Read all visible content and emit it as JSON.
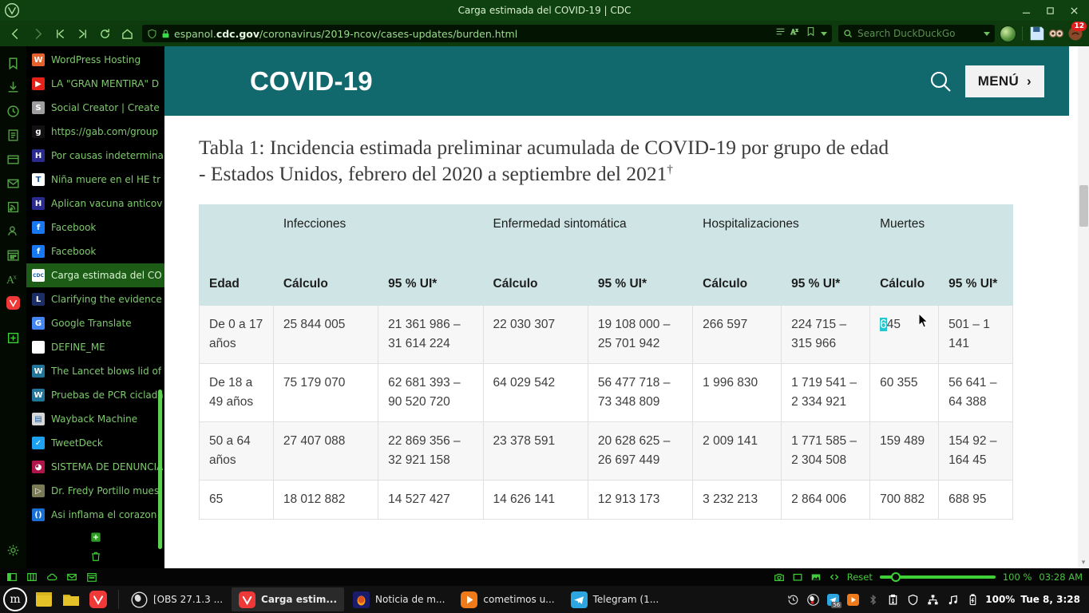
{
  "window": {
    "title": "Carga estimada del COVID-19 | CDC",
    "minimize": "–",
    "maximize": "❐",
    "close": "✕"
  },
  "toolbar": {
    "back_icon": "back-arrow-icon",
    "forward_icon": "forward-arrow-icon",
    "rewind_icon": "rewind-icon",
    "fastforward_icon": "fast-forward-icon",
    "reload_icon": "reload-icon",
    "home_icon": "home-icon",
    "url": "espanol.cdc.gov/coronavirus/2019-ncov/cases-updates/burden.html",
    "url_domain": "cdc.gov",
    "url_prefix": "espanol.",
    "url_suffix": "/coronavirus/2019-ncov/cases-updates/burden.html",
    "search_placeholder": "Search DuckDuckGo",
    "extension_badge": "12"
  },
  "panel_icons": [
    "bookmarks-panel-icon",
    "downloads-panel-icon",
    "history-panel-icon",
    "notes-panel-icon",
    "window-panel-icon",
    "mail-panel-icon",
    "feeds-panel-icon",
    "contacts-panel-icon",
    "calendar-panel-icon",
    "translate-panel-icon",
    "vivaldi-panel-icon",
    "add-panel-icon",
    "settings-panel-icon"
  ],
  "bookmarks": {
    "items": [
      {
        "label": "WordPress Hosting",
        "favicon": "wordpress-favicon",
        "color": "#e8602c",
        "glyph": "W",
        "selected": false
      },
      {
        "label": "LA \"GRAN MENTIRA\" D",
        "favicon": "youtube-favicon",
        "color": "#e62117",
        "glyph": "▶",
        "selected": false
      },
      {
        "label": "Social Creator | Create",
        "favicon": "social-creator-favicon",
        "color": "#9e9e9e",
        "glyph": "S",
        "selected": false
      },
      {
        "label": "https://gab.com/group",
        "favicon": "gab-favicon",
        "color": "#111111",
        "glyph": "g",
        "selected": false
      },
      {
        "label": "Por causas indetermina",
        "favicon": "h-favicon",
        "color": "#2b2b8f",
        "glyph": "H",
        "selected": false
      },
      {
        "label": "Niña muere en el HE tr",
        "favicon": "telegraph-favicon",
        "color": "#ffffff",
        "glyph": "T",
        "selected": false
      },
      {
        "label": "Aplican vacuna anticov",
        "favicon": "h-favicon",
        "color": "#2b2b8f",
        "glyph": "H",
        "selected": false
      },
      {
        "label": "Facebook",
        "favicon": "facebook-favicon",
        "color": "#1877f2",
        "glyph": "f",
        "selected": false
      },
      {
        "label": "Facebook",
        "favicon": "facebook-favicon",
        "color": "#1877f2",
        "glyph": "f",
        "selected": false
      },
      {
        "label": "Carga estimada del CO",
        "favicon": "cdc-favicon",
        "color": "#ffffff",
        "glyph": "CDC",
        "selected": true
      },
      {
        "label": "Clarifying the evidence",
        "favicon": "lancet-favicon",
        "color": "#1c2e66",
        "glyph": "L",
        "selected": false
      },
      {
        "label": "Google Translate",
        "favicon": "google-translate-favicon",
        "color": "#4285f4",
        "glyph": "G",
        "selected": false
      },
      {
        "label": "DEFINE_ME",
        "favicon": "blank-favicon",
        "color": "#ffffff",
        "glyph": "",
        "selected": false
      },
      {
        "label": "The Lancet blows lid of",
        "favicon": "wordpress-favicon",
        "color": "#21759b",
        "glyph": "W",
        "selected": false
      },
      {
        "label": "Pruebas de PCR ciclada",
        "favicon": "wordpress-favicon",
        "color": "#21759b",
        "glyph": "W",
        "selected": false
      },
      {
        "label": "Wayback Machine",
        "favicon": "document-favicon",
        "color": "#d8d8d8",
        "glyph": "▤",
        "selected": false
      },
      {
        "label": "TweetDeck",
        "favicon": "twitter-favicon",
        "color": "#1da1f2",
        "glyph": "✓",
        "selected": false
      },
      {
        "label": "SISTEMA DE DENUNCIA",
        "favicon": "denuncia-favicon",
        "color": "#b0144a",
        "glyph": "◕",
        "selected": false
      },
      {
        "label": "Dr. Fredy Portillo mues",
        "favicon": "bitchute-favicon",
        "color": "#7a7a55",
        "glyph": "▷",
        "selected": false
      },
      {
        "label": "Asi inflama el corazon l",
        "favicon": "link-favicon",
        "color": "#1a6fd4",
        "glyph": "()",
        "selected": false
      }
    ],
    "add_icon": "add-bookmark-icon",
    "delete_icon": "trash-icon"
  },
  "cdc_page": {
    "brand": "COVID-19",
    "search_icon": "search-icon",
    "menu_label": "MENÚ",
    "menu_chevron": "›",
    "table_caption": "Tabla 1: Incidencia estimada preliminar acumulada de COVID-19 por grupo de edad - Estados Unidos, febrero del 2020 a septiembre del 2021",
    "caption_dagger": "†"
  },
  "chart_data": {
    "type": "table",
    "title": "Tabla 1: Incidencia estimada preliminar acumulada de COVID-19 por grupo de edad - Estados Unidos, febrero del 2020 a septiembre del 2021†",
    "group_headers": [
      "",
      "Infecciones",
      "",
      "Enfermedad sintomática",
      "",
      "Hospitalizaciones",
      "",
      "Muertes",
      ""
    ],
    "columns": [
      "Edad",
      "Cálculo",
      "95 % UI*",
      "Cálculo",
      "95 % UI*",
      "Cálculo",
      "95 % UI*",
      "Cálculo",
      "95 % UI*"
    ],
    "rows": [
      {
        "edad": "De 0 a 17 años",
        "inf_calculo": "25 844 005",
        "inf_ui": "21 361 986 – 31 614 224",
        "sint_calculo": "22 030 307",
        "sint_ui": "19 108 000 – 25 701 942",
        "hosp_calculo": "266 597",
        "hosp_ui": "224 715 – 315 966",
        "muertes_calculo": "645",
        "muertes_calculo_selected_prefix": "6",
        "muertes_calculo_rest": "45",
        "muertes_ui": "501 – 1 141"
      },
      {
        "edad": "De 18 a 49 años",
        "inf_calculo": "75 179 070",
        "inf_ui": "62 681 393 – 90 520 720",
        "sint_calculo": "64 029 542",
        "sint_ui": "56 477 718 – 73 348 809",
        "hosp_calculo": "1 996 830",
        "hosp_ui": "1 719 541 – 2 334 921",
        "muertes_calculo": "60 355",
        "muertes_ui": "56 641 – 64 388"
      },
      {
        "edad": "50 a 64 años",
        "inf_calculo": "27 407 088",
        "inf_ui": "22 869 356 – 32 921 158",
        "sint_calculo": "23 378 591",
        "sint_ui": "20 628 625 – 26 697 449",
        "hosp_calculo": "2 009 141",
        "hosp_ui": "1 771 585 – 2 304 508",
        "muertes_calculo": "159 489",
        "muertes_ui": "154 92 – 164 45"
      },
      {
        "edad": "65",
        "inf_calculo": "18 012 882",
        "inf_ui": "14 527 427",
        "sint_calculo": "14 626 141",
        "sint_ui": "12 913 173",
        "hosp_calculo": "3 232 213",
        "hosp_ui": "2 864 006",
        "muertes_calculo": "700 882",
        "muertes_ui": "688 95"
      }
    ]
  },
  "obs_strip": {
    "camera_icon": "screenshot-icon",
    "window_icon": "window-capture-icon",
    "image_icon": "image-capture-icon",
    "code_icon": "code-icon",
    "reset_label": "Reset",
    "zoom_value": "100 %",
    "clock": "03:28 AM"
  },
  "taskbar": {
    "start_glyph": "m",
    "launchers": [
      "notes-launcher",
      "files-launcher",
      "vivaldi-launcher"
    ],
    "items": [
      {
        "label": "[OBS 27.1.3 ...",
        "icon": "obs-icon",
        "color": "#3a3a3a",
        "active": false
      },
      {
        "label": "Carga estim...",
        "icon": "vivaldi-icon",
        "color": "#ef3939",
        "active": true
      },
      {
        "label": "Noticia de m...",
        "icon": "firefox-icon",
        "color": "#1b1b6b",
        "active": false
      },
      {
        "label": "cometimos u...",
        "icon": "vlc-icon",
        "color": "#ee7a1b",
        "active": false
      },
      {
        "label": "Telegram (1...",
        "icon": "telegram-icon",
        "color": "#2ca5e0",
        "active": false
      }
    ],
    "tray_apps": [
      {
        "icon": "history-tray-icon",
        "badge": ""
      },
      {
        "icon": "obs-tray-icon",
        "badge": ""
      },
      {
        "icon": "telegram-tray-icon",
        "badge": "56"
      },
      {
        "icon": "vlc-tray-icon",
        "badge": ""
      }
    ],
    "tray_icons": [
      "bluetooth-icon",
      "clipboard-icon",
      "shield-icon",
      "network-icon",
      "music-icon",
      "battery-icon"
    ],
    "battery": "100%",
    "clock": "Tue 8, 3:28"
  }
}
